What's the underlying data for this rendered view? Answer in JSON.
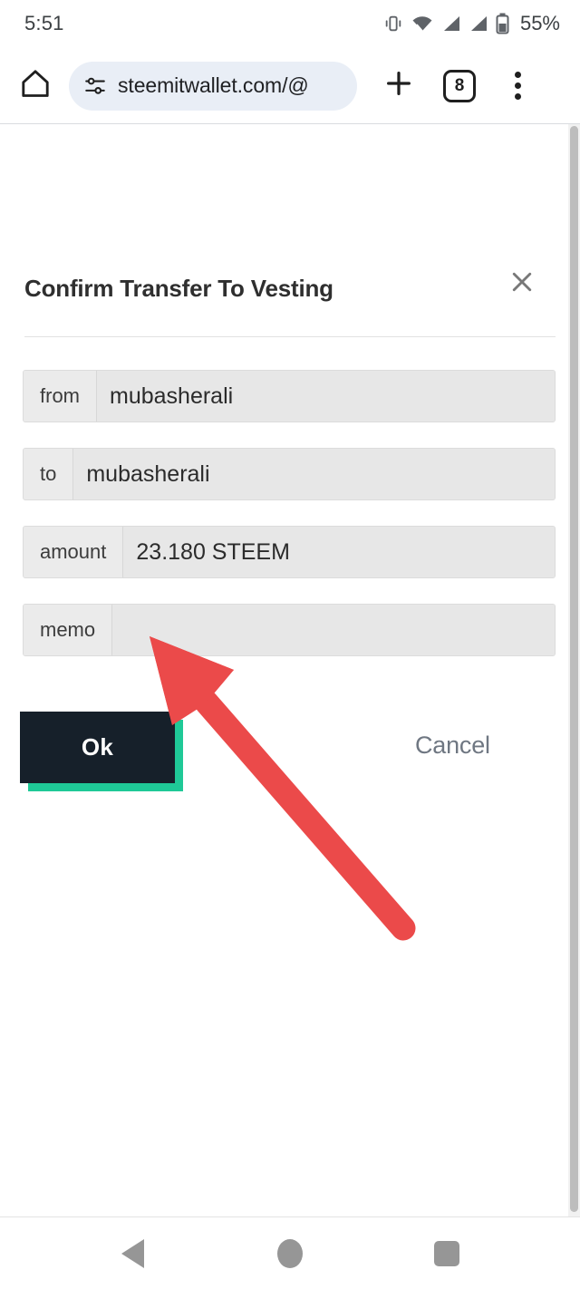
{
  "status_bar": {
    "time": "5:51",
    "battery_percent": "55%",
    "icons": [
      "vibrate-icon",
      "wifi-icon",
      "signal-icon",
      "signal-icon",
      "battery-icon"
    ]
  },
  "browser": {
    "home_icon": "home-icon",
    "site_settings_icon": "tune-icon",
    "url": "steemitwallet.com/@",
    "new_tab_icon": "plus-icon",
    "tab_count": "8",
    "menu_icon": "more-vertical-icon"
  },
  "dialog": {
    "title": "Confirm Transfer To Vesting",
    "close_icon": "close-icon",
    "fields": [
      {
        "label": "from",
        "value": "mubasherali"
      },
      {
        "label": "to",
        "value": "mubasherali"
      },
      {
        "label": "amount",
        "value": "23.180 STEEM"
      },
      {
        "label": "memo",
        "value": ""
      }
    ],
    "ok_label": "Ok",
    "cancel_label": "Cancel"
  },
  "annotation": {
    "arrow_icon": "red-arrow-pointer",
    "arrow_color": "#eb4a4a",
    "points_to": "Ok"
  },
  "colors": {
    "ok_button_bg": "#16202a",
    "ok_button_shadow": "#1fc997",
    "cancel_text": "#6f7782",
    "field_bg": "#e7e7e7",
    "field_label_bg": "#ebebeb",
    "url_pill_bg": "#e9eef6"
  },
  "nav_bar": {
    "back_icon": "back-triangle-icon",
    "home_icon": "home-circle-icon",
    "recents_icon": "recents-square-icon"
  }
}
